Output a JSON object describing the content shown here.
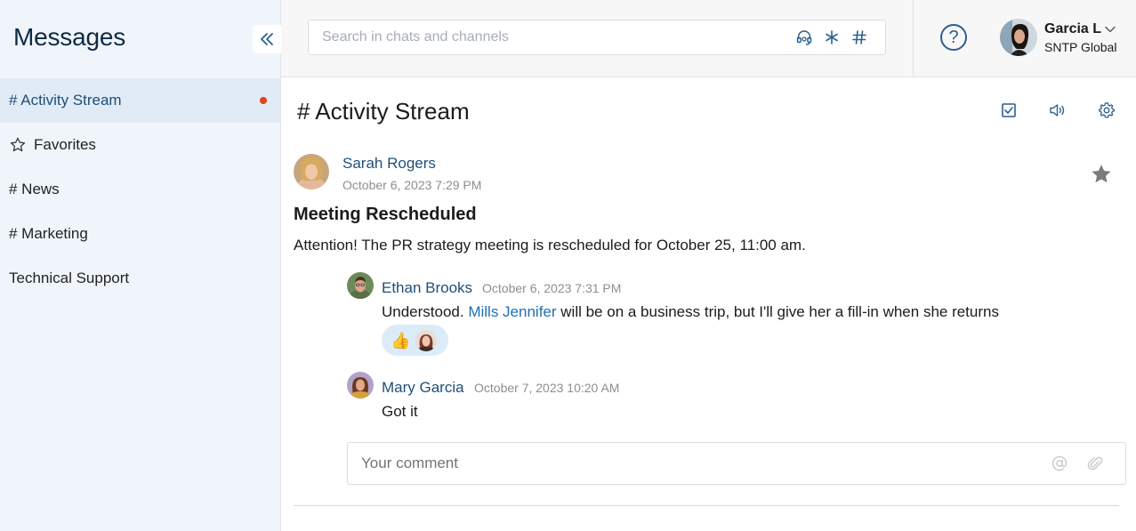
{
  "sidebar": {
    "title": "Messages",
    "collapse_icon": "double-chevron-left-icon",
    "items": [
      {
        "label": "# Activity Stream",
        "active": true,
        "unread": true
      },
      {
        "label": "Favorites",
        "icon": "star-outline-icon"
      },
      {
        "label": "# News"
      },
      {
        "label": "# Marketing"
      },
      {
        "label": "Technical Support"
      }
    ]
  },
  "topbar": {
    "search_placeholder": "Search in chats and channels",
    "search_icons": [
      "headset-icon",
      "asterisk-icon",
      "hash-icon"
    ],
    "help_icon": "?",
    "user": {
      "name": "Garcia L",
      "org": "SNTP Global"
    }
  },
  "channel": {
    "title": "# Activity Stream",
    "tool_icons": [
      "checkbox-icon",
      "speaker-icon",
      "gear-icon"
    ]
  },
  "post": {
    "author": "Sarah Rogers",
    "time": "October 6, 2023 7:29 PM",
    "title": "Meeting Rescheduled",
    "body": "Attention! The PR strategy meeting is rescheduled for October 25, 11:00 am."
  },
  "comments": [
    {
      "author": "Ethan Brooks",
      "time": "October 6, 2023 7:31 PM",
      "text_before": "Understood. ",
      "mention": "Mills Jennifer",
      "text_after": " will be on a business trip, but I'll give her a fill-in when she returns",
      "reaction_emoji": "👍"
    },
    {
      "author": "Mary Garcia",
      "time": "October 7, 2023 10:20 AM",
      "text": "Got it"
    }
  ],
  "comment_box": {
    "placeholder": "Your comment",
    "icons": [
      "at-icon",
      "paperclip-icon"
    ]
  },
  "colors": {
    "accent": "#1f4e79",
    "sidebar_bg": "#f0f5fb",
    "active_bg": "#e1ebf5",
    "unread_dot": "#e2431b",
    "reaction_bg": "#dcebf8"
  }
}
